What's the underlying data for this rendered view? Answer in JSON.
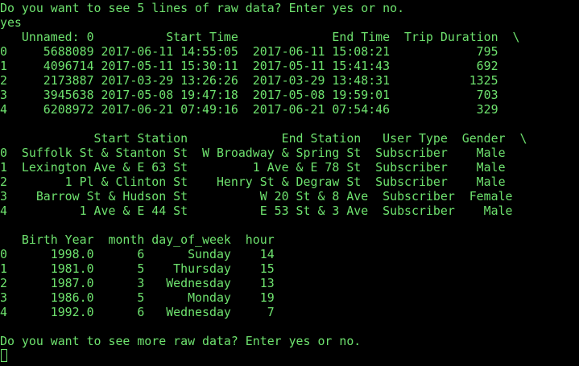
{
  "colors": {
    "background": "#000000",
    "text": "#6ee26e"
  },
  "terminal": {
    "lines": [
      "Do you want to see 5 lines of raw data? Enter yes or no.",
      "yes",
      "   Unnamed: 0          Start Time             End Time  Trip Duration  \\",
      "0     5688089 2017-06-11 14:55:05  2017-06-11 15:08:21            795",
      "1     4096714 2017-05-11 15:30:11  2017-05-11 15:41:43            692",
      "2     2173887 2017-03-29 13:26:26  2017-03-29 13:48:31           1325",
      "3     3945638 2017-05-08 19:47:18  2017-05-08 19:59:01            703",
      "4     6208972 2017-06-21 07:49:16  2017-06-21 07:54:46            329",
      "",
      "             Start Station             End Station   User Type  Gender  \\",
      "0  Suffolk St & Stanton St  W Broadway & Spring St  Subscriber    Male",
      "1  Lexington Ave & E 63 St         1 Ave & E 78 St  Subscriber    Male",
      "2        1 Pl & Clinton St    Henry St & Degraw St  Subscriber    Male",
      "3    Barrow St & Hudson St          W 20 St & 8 Ave  Subscriber  Female",
      "4          1 Ave & E 44 St          E 53 St & 3 Ave  Subscriber    Male",
      "",
      "   Birth Year  month day_of_week  hour",
      "0      1998.0      6      Sunday    14",
      "1      1981.0      5    Thursday    15",
      "2      1987.0      3   Wednesday    13",
      "3      1986.0      5      Monday    19",
      "4      1992.0      6   Wednesday     7",
      "",
      "Do you want to see more raw data? Enter yes or no.",
      ""
    ]
  }
}
